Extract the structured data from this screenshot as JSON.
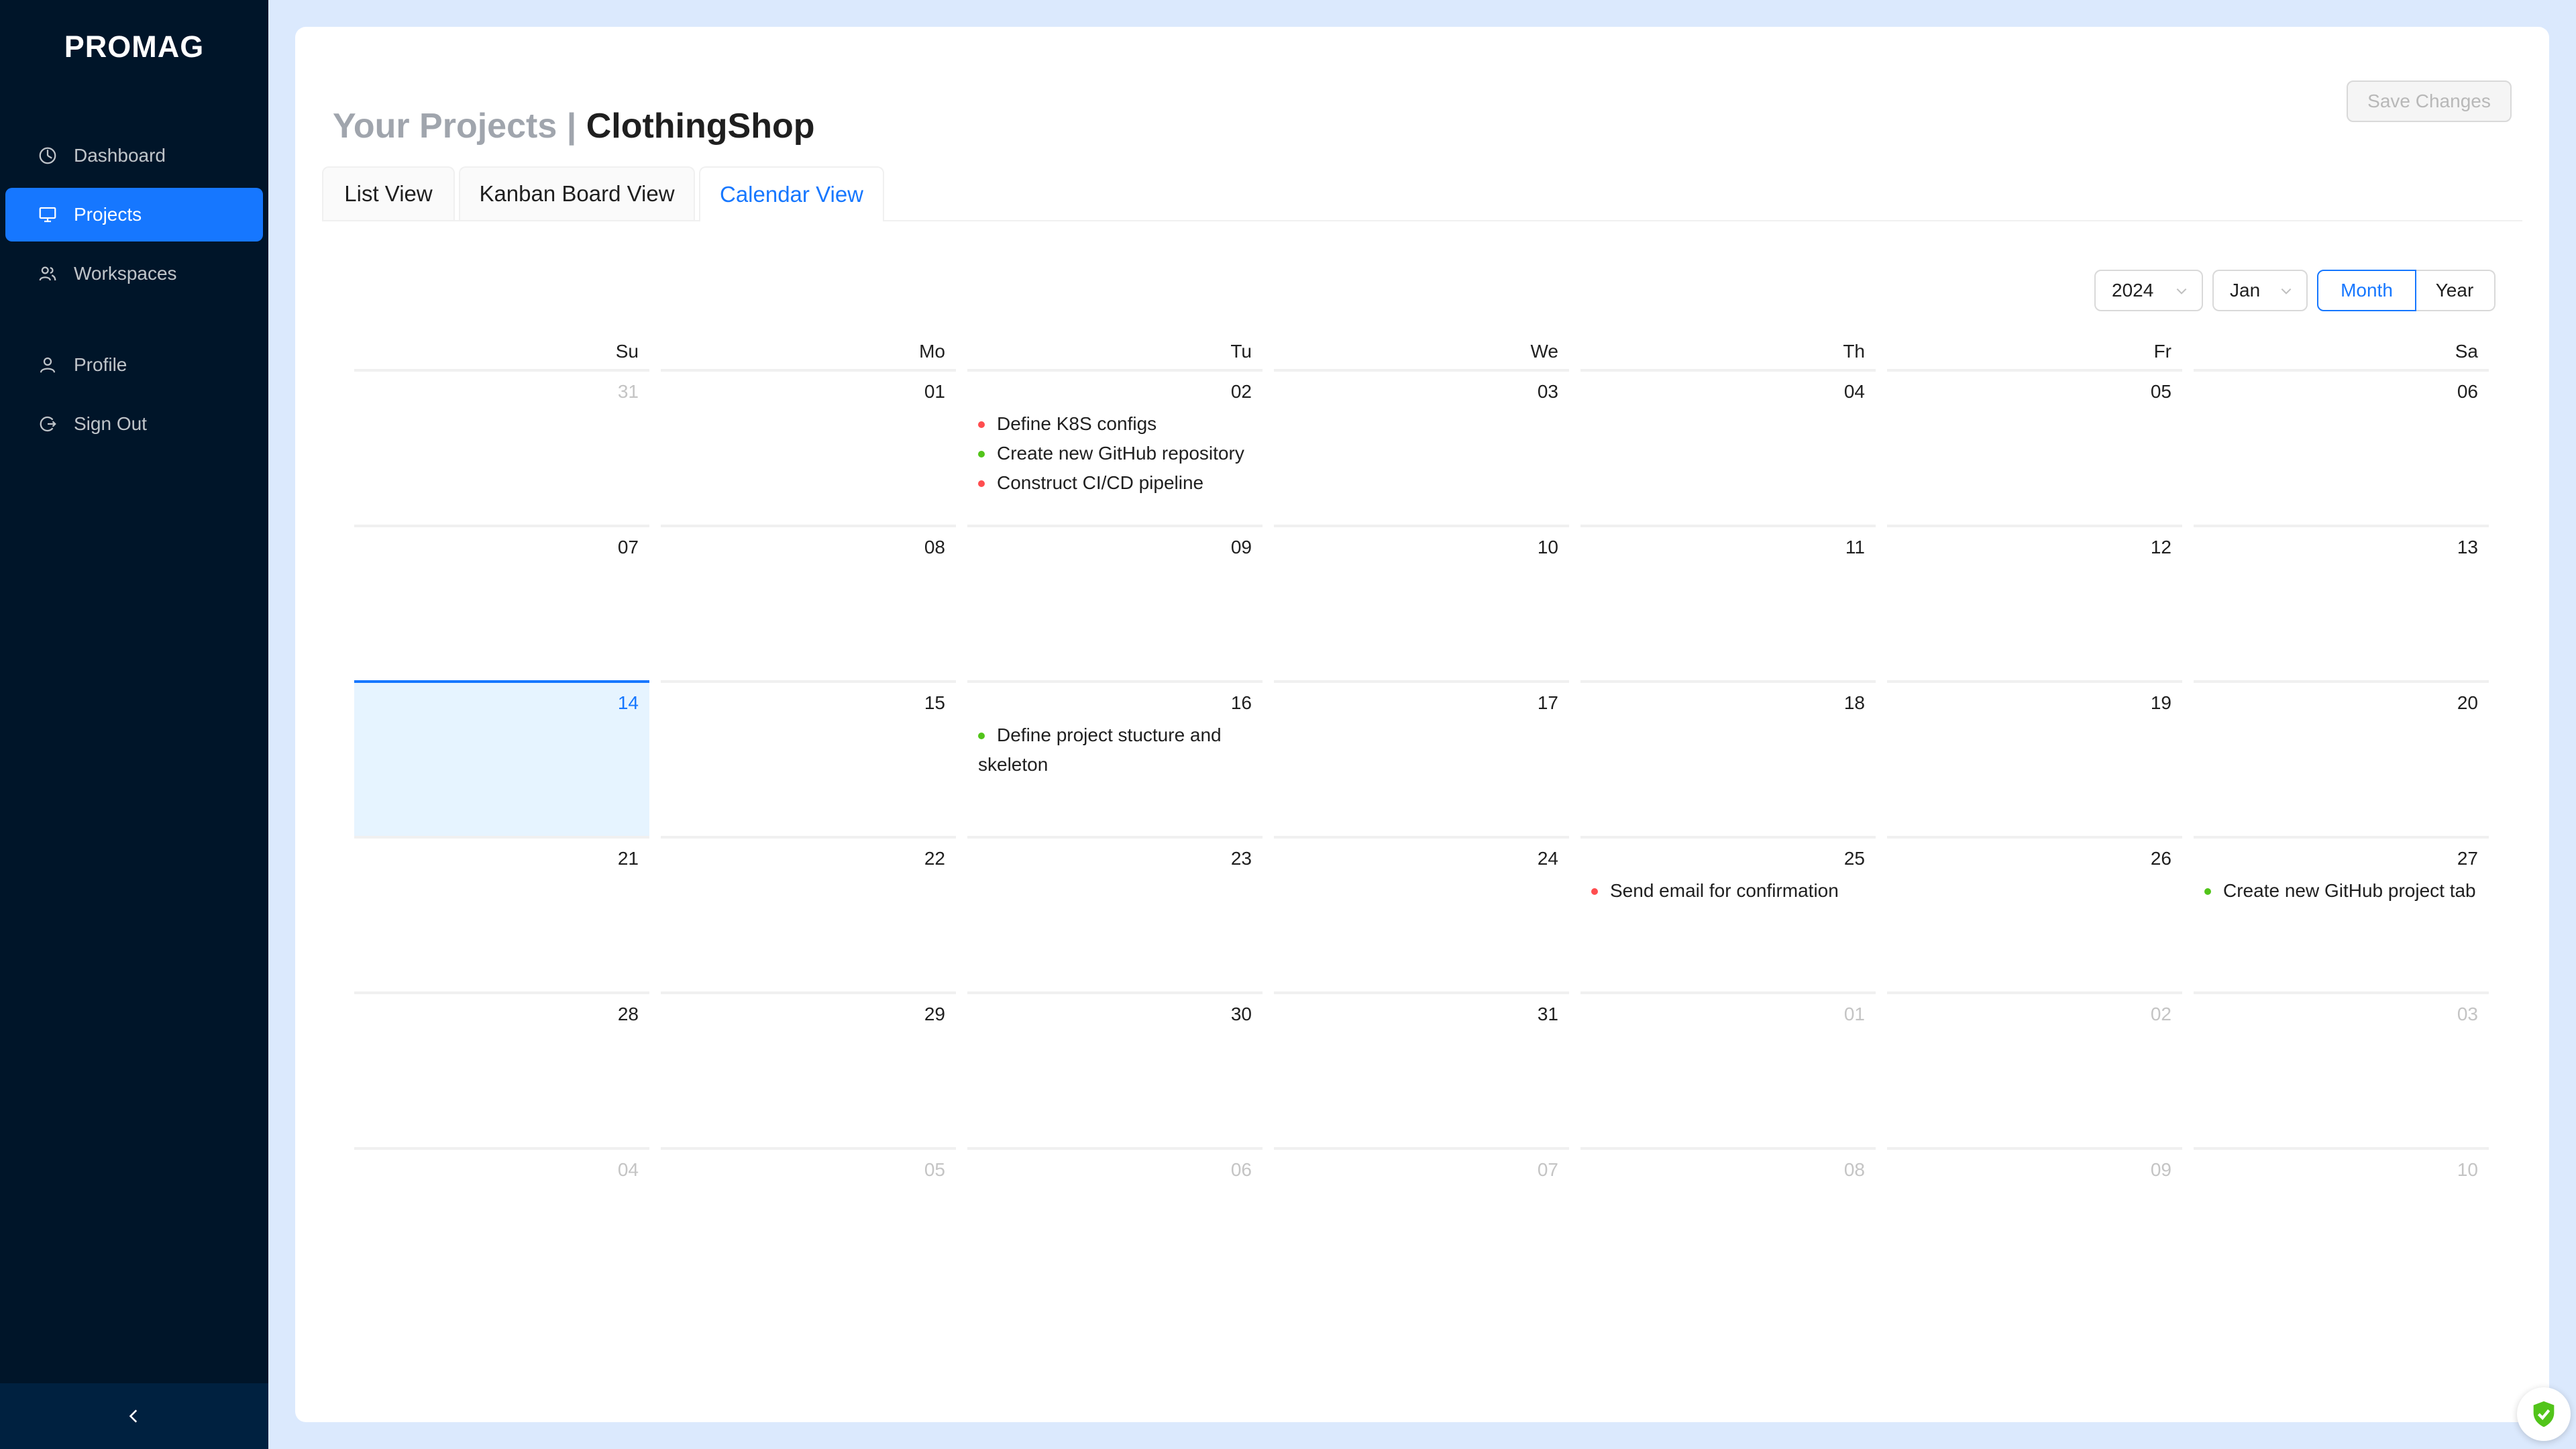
{
  "app": {
    "logo": "PROMAG"
  },
  "sidebar": {
    "items": [
      {
        "label": "Dashboard",
        "icon": "dashboard-icon",
        "active": false
      },
      {
        "label": "Projects",
        "icon": "monitor-icon",
        "active": true
      },
      {
        "label": "Workspaces",
        "icon": "team-icon",
        "active": false
      },
      {
        "label": "Profile",
        "icon": "user-icon",
        "active": false
      },
      {
        "label": "Sign Out",
        "icon": "logout-icon",
        "active": false
      }
    ]
  },
  "header": {
    "title_prefix": "Your Projects |",
    "project_name": "ClothingShop",
    "save_label": "Save Changes"
  },
  "tabs": [
    {
      "label": "List View",
      "active": false
    },
    {
      "label": "Kanban Board View",
      "active": false
    },
    {
      "label": "Calendar View",
      "active": true
    }
  ],
  "calendar": {
    "year": "2024",
    "month": "Jan",
    "mode_month": "Month",
    "mode_year": "Year",
    "weekdays": [
      "Su",
      "Mo",
      "Tu",
      "We",
      "Th",
      "Fr",
      "Sa"
    ],
    "weeks": [
      [
        {
          "day": "31",
          "out": true,
          "events": []
        },
        {
          "day": "01",
          "events": []
        },
        {
          "day": "02",
          "events": [
            {
              "text": "Define K8S configs",
              "status": "red"
            },
            {
              "text": "Create new GitHub repository",
              "status": "green"
            },
            {
              "text": "Construct CI/CD pipeline",
              "status": "red"
            }
          ]
        },
        {
          "day": "03",
          "events": []
        },
        {
          "day": "04",
          "events": []
        },
        {
          "day": "05",
          "events": []
        },
        {
          "day": "06",
          "events": []
        }
      ],
      [
        {
          "day": "07",
          "events": []
        },
        {
          "day": "08",
          "events": []
        },
        {
          "day": "09",
          "events": []
        },
        {
          "day": "10",
          "events": []
        },
        {
          "day": "11",
          "events": []
        },
        {
          "day": "12",
          "events": []
        },
        {
          "day": "13",
          "events": []
        }
      ],
      [
        {
          "day": "14",
          "today": true,
          "events": []
        },
        {
          "day": "15",
          "events": []
        },
        {
          "day": "16",
          "events": [
            {
              "text": "Define project stucture and skeleton",
              "status": "green"
            }
          ]
        },
        {
          "day": "17",
          "events": []
        },
        {
          "day": "18",
          "events": []
        },
        {
          "day": "19",
          "events": []
        },
        {
          "day": "20",
          "events": []
        }
      ],
      [
        {
          "day": "21",
          "events": []
        },
        {
          "day": "22",
          "events": []
        },
        {
          "day": "23",
          "events": []
        },
        {
          "day": "24",
          "events": []
        },
        {
          "day": "25",
          "events": [
            {
              "text": "Send email for confirmation",
              "status": "red"
            }
          ]
        },
        {
          "day": "26",
          "events": []
        },
        {
          "day": "27",
          "events": [
            {
              "text": "Create new GitHub project tab",
              "status": "green"
            }
          ]
        }
      ],
      [
        {
          "day": "28",
          "events": []
        },
        {
          "day": "29",
          "events": []
        },
        {
          "day": "30",
          "events": []
        },
        {
          "day": "31",
          "events": []
        },
        {
          "day": "01",
          "out": true,
          "events": []
        },
        {
          "day": "02",
          "out": true,
          "events": []
        },
        {
          "day": "03",
          "out": true,
          "events": []
        }
      ],
      [
        {
          "day": "04",
          "out": true,
          "events": []
        },
        {
          "day": "05",
          "out": true,
          "events": []
        },
        {
          "day": "06",
          "out": true,
          "events": []
        },
        {
          "day": "07",
          "out": true,
          "events": []
        },
        {
          "day": "08",
          "out": true,
          "events": []
        },
        {
          "day": "09",
          "out": true,
          "events": []
        },
        {
          "day": "10",
          "out": true,
          "events": []
        }
      ]
    ]
  },
  "colors": {
    "sidebar_bg": "#001529",
    "accent": "#1677ff",
    "status_red": "#ff4d4f",
    "status_green": "#52c41a",
    "page_bg": "#dbe9fd"
  },
  "widgets": {
    "security_badge_icon": "shield-check-icon",
    "collapse_icon": "chevron-left-icon"
  }
}
